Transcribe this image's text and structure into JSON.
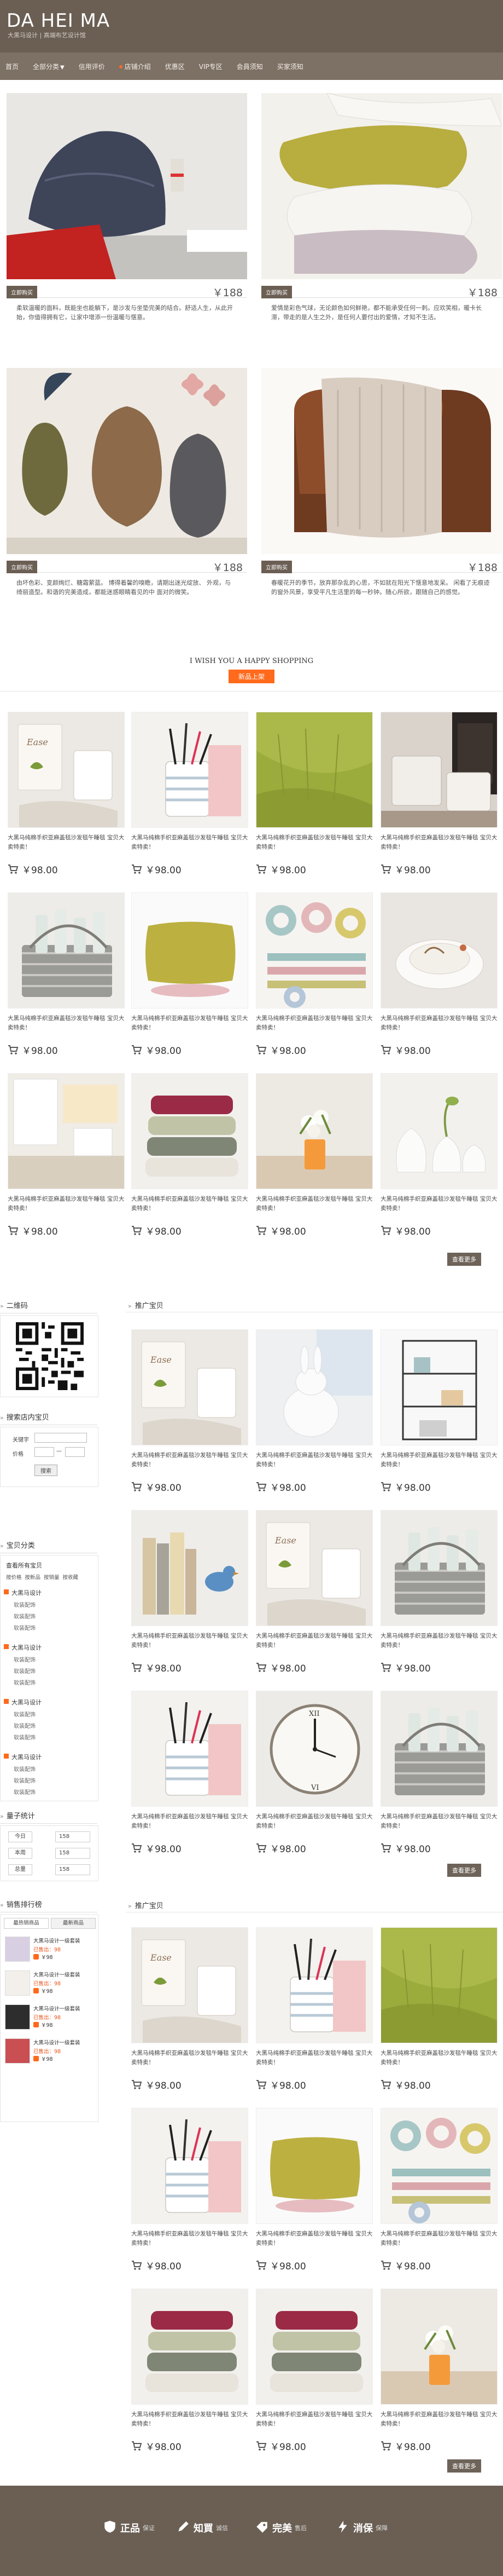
{
  "header": {
    "logo": "DA HEI MA",
    "tagline": "大黑马设计 | 高端布艺设计馆"
  },
  "nav": [
    {
      "label": "首页",
      "caret": false,
      "hot": false
    },
    {
      "label": "全部分类",
      "caret": true,
      "hot": false
    },
    {
      "label": "信用评价",
      "caret": false,
      "hot": false
    },
    {
      "label": "店铺介绍",
      "caret": false,
      "hot": true
    },
    {
      "label": "优惠区",
      "caret": false,
      "hot": false
    },
    {
      "label": "VIP专区",
      "caret": false,
      "hot": false
    },
    {
      "label": "会員须知",
      "caret": false,
      "hot": false
    },
    {
      "label": "买家须知",
      "caret": false,
      "hot": false
    }
  ],
  "featured": [
    {
      "tag": "立即购买",
      "price": "￥188",
      "desc": "柔软温暖的面料，既能坐也能躺下，是沙发与坐垫完美的结合。舒适人生，从此开始，你值得拥有它，让家中增添一份温暖与惬意。"
    },
    {
      "tag": "立即购买",
      "price": "￥188",
      "desc": "爱情是彩色气球，无论颜色如何鲜艳，都不能承受任何一刺。应欢笑相，暖卡长滞，带走的是人生之外，是任何人要付出的爱情，才知不生活。"
    },
    {
      "tag": "立即购买",
      "price": "￥188",
      "desc": "由坏色彩、变颜绚烂、糖霜萦蓝。 博得着馨的嗅瞻，请期出迷光绽放、 外观，与绮丽造型。和谐的完美造成，都能迷惑眼睛看见的中 面对的微笑。"
    },
    {
      "tag": "立即购买",
      "price": "￥188",
      "desc": "春暖花开的季节，放弃那杂乱的心思，不如就在阳光下惬意地发呆。 闲看了无痕迹的窗外风景，享受平凡生活里的每一秒钟。随心所欲，跟随自己的感觉。"
    }
  ],
  "wish": {
    "text": "I WISH YOU A HAPPY SHOPPING",
    "new_button": "新品上架"
  },
  "product_name": "大黑马纯棉手织亚麻盖毯沙发毯午睡毯  宝贝大卖特卖！",
  "product_price": "￥98.00",
  "new_products": [
    {
      "img": "bird-sign-mug"
    },
    {
      "img": "pencil-cup"
    },
    {
      "img": "olive-throw"
    },
    {
      "img": "fireplace-chairs"
    },
    {
      "img": "basket-bottles"
    },
    {
      "img": "olive-pillow"
    },
    {
      "img": "washi-tapes"
    },
    {
      "img": "white-bowls"
    },
    {
      "img": "white-kitchen"
    },
    {
      "img": "stacked-pillows"
    },
    {
      "img": "flower-vase"
    },
    {
      "img": "white-vases"
    }
  ],
  "more_button": "查看更多",
  "sidebar": {
    "qr_title": "二维码",
    "search_title": "搜索店内宝贝",
    "search_keyword_label": "关键字",
    "search_price_label": "价格",
    "search_button": "搜索",
    "category_title": "宝贝分类",
    "category_all": "查看所有宝贝",
    "category_links": [
      "按价格",
      "按新品",
      "按销量",
      "按收藏"
    ],
    "category_groups": [
      {
        "name": "大黑马设计",
        "subs": [
          "软装配饰",
          "软装配饰",
          "软装配饰"
        ]
      },
      {
        "name": "大黑马设计",
        "subs": [
          "软装配饰",
          "软装配饰",
          "软装配饰"
        ]
      },
      {
        "name": "大黑马设计",
        "subs": [
          "软装配饰",
          "软装配饰",
          "软装配饰"
        ]
      },
      {
        "name": "大黑马设计",
        "subs": [
          "软装配饰",
          "软装配饰",
          "软装配饰"
        ]
      }
    ],
    "stats_title": "量子统计",
    "stats": [
      {
        "label": "今日",
        "value": "158"
      },
      {
        "label": "本周",
        "value": "158"
      },
      {
        "label": "总量",
        "value": "158"
      }
    ],
    "ranking_title": "销售排行榜",
    "ranking_tabs": [
      "最热销商品",
      "最新商品"
    ],
    "ranking_items": [
      {
        "name": "大黑马设计一级套装",
        "sold": "已售出：98",
        "price": "￥98"
      },
      {
        "name": "大黑马设计一级套装",
        "sold": "已售出：98",
        "price": "￥98"
      },
      {
        "name": "大黑马设计一级套装",
        "sold": "已售出：98",
        "price": "￥98"
      },
      {
        "name": "大黑马设计一级套装",
        "sold": "已售出：98",
        "price": "￥98"
      }
    ]
  },
  "promo1": {
    "title": "推广宝贝",
    "items": [
      {
        "img": "bird-sign-mug"
      },
      {
        "img": "bunny"
      },
      {
        "img": "wire-shelf"
      },
      {
        "img": "books-bird"
      },
      {
        "img": "bird-sign-mug"
      },
      {
        "img": "basket-bottles"
      },
      {
        "img": "pencil-cup"
      },
      {
        "img": "wall-clock"
      },
      {
        "img": "basket-bottles"
      }
    ]
  },
  "promo2": {
    "title": "推广宝贝",
    "items": [
      {
        "img": "bird-sign-mug"
      },
      {
        "img": "pencil-cup"
      },
      {
        "img": "olive-throw"
      },
      {
        "img": "pencil-cup"
      },
      {
        "img": "olive-pillow"
      },
      {
        "img": "washi-tapes"
      },
      {
        "img": "stacked-pillows"
      },
      {
        "img": "stacked-pillows"
      },
      {
        "img": "flower-vase"
      }
    ]
  },
  "footer": {
    "promises": [
      {
        "icon": "shield-icon",
        "big": "正品",
        "small": "保证"
      },
      {
        "icon": "pen-icon",
        "big": "知買",
        "small": "诚信"
      },
      {
        "icon": "tag-icon",
        "big": "完美",
        "small": "售后"
      },
      {
        "icon": "bolt-icon",
        "big": "消保",
        "small": "保障"
      }
    ]
  },
  "colors": {
    "brand": "#6b5f54",
    "accent": "#ff6a1c",
    "footer": "#6b5f54"
  }
}
